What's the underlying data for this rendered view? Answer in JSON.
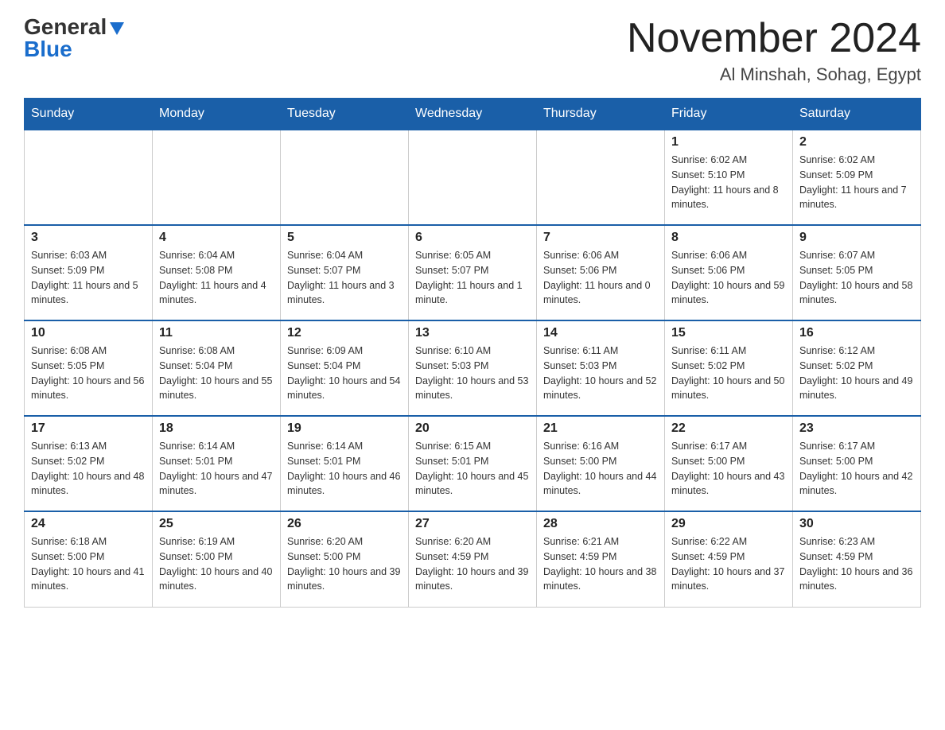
{
  "header": {
    "logo_general": "General",
    "logo_blue": "Blue",
    "month_year": "November 2024",
    "location": "Al Minshah, Sohag, Egypt"
  },
  "weekdays": [
    "Sunday",
    "Monday",
    "Tuesday",
    "Wednesday",
    "Thursday",
    "Friday",
    "Saturday"
  ],
  "weeks": [
    [
      {
        "day": "",
        "info": ""
      },
      {
        "day": "",
        "info": ""
      },
      {
        "day": "",
        "info": ""
      },
      {
        "day": "",
        "info": ""
      },
      {
        "day": "",
        "info": ""
      },
      {
        "day": "1",
        "info": "Sunrise: 6:02 AM\nSunset: 5:10 PM\nDaylight: 11 hours and 8 minutes."
      },
      {
        "day": "2",
        "info": "Sunrise: 6:02 AM\nSunset: 5:09 PM\nDaylight: 11 hours and 7 minutes."
      }
    ],
    [
      {
        "day": "3",
        "info": "Sunrise: 6:03 AM\nSunset: 5:09 PM\nDaylight: 11 hours and 5 minutes."
      },
      {
        "day": "4",
        "info": "Sunrise: 6:04 AM\nSunset: 5:08 PM\nDaylight: 11 hours and 4 minutes."
      },
      {
        "day": "5",
        "info": "Sunrise: 6:04 AM\nSunset: 5:07 PM\nDaylight: 11 hours and 3 minutes."
      },
      {
        "day": "6",
        "info": "Sunrise: 6:05 AM\nSunset: 5:07 PM\nDaylight: 11 hours and 1 minute."
      },
      {
        "day": "7",
        "info": "Sunrise: 6:06 AM\nSunset: 5:06 PM\nDaylight: 11 hours and 0 minutes."
      },
      {
        "day": "8",
        "info": "Sunrise: 6:06 AM\nSunset: 5:06 PM\nDaylight: 10 hours and 59 minutes."
      },
      {
        "day": "9",
        "info": "Sunrise: 6:07 AM\nSunset: 5:05 PM\nDaylight: 10 hours and 58 minutes."
      }
    ],
    [
      {
        "day": "10",
        "info": "Sunrise: 6:08 AM\nSunset: 5:05 PM\nDaylight: 10 hours and 56 minutes."
      },
      {
        "day": "11",
        "info": "Sunrise: 6:08 AM\nSunset: 5:04 PM\nDaylight: 10 hours and 55 minutes."
      },
      {
        "day": "12",
        "info": "Sunrise: 6:09 AM\nSunset: 5:04 PM\nDaylight: 10 hours and 54 minutes."
      },
      {
        "day": "13",
        "info": "Sunrise: 6:10 AM\nSunset: 5:03 PM\nDaylight: 10 hours and 53 minutes."
      },
      {
        "day": "14",
        "info": "Sunrise: 6:11 AM\nSunset: 5:03 PM\nDaylight: 10 hours and 52 minutes."
      },
      {
        "day": "15",
        "info": "Sunrise: 6:11 AM\nSunset: 5:02 PM\nDaylight: 10 hours and 50 minutes."
      },
      {
        "day": "16",
        "info": "Sunrise: 6:12 AM\nSunset: 5:02 PM\nDaylight: 10 hours and 49 minutes."
      }
    ],
    [
      {
        "day": "17",
        "info": "Sunrise: 6:13 AM\nSunset: 5:02 PM\nDaylight: 10 hours and 48 minutes."
      },
      {
        "day": "18",
        "info": "Sunrise: 6:14 AM\nSunset: 5:01 PM\nDaylight: 10 hours and 47 minutes."
      },
      {
        "day": "19",
        "info": "Sunrise: 6:14 AM\nSunset: 5:01 PM\nDaylight: 10 hours and 46 minutes."
      },
      {
        "day": "20",
        "info": "Sunrise: 6:15 AM\nSunset: 5:01 PM\nDaylight: 10 hours and 45 minutes."
      },
      {
        "day": "21",
        "info": "Sunrise: 6:16 AM\nSunset: 5:00 PM\nDaylight: 10 hours and 44 minutes."
      },
      {
        "day": "22",
        "info": "Sunrise: 6:17 AM\nSunset: 5:00 PM\nDaylight: 10 hours and 43 minutes."
      },
      {
        "day": "23",
        "info": "Sunrise: 6:17 AM\nSunset: 5:00 PM\nDaylight: 10 hours and 42 minutes."
      }
    ],
    [
      {
        "day": "24",
        "info": "Sunrise: 6:18 AM\nSunset: 5:00 PM\nDaylight: 10 hours and 41 minutes."
      },
      {
        "day": "25",
        "info": "Sunrise: 6:19 AM\nSunset: 5:00 PM\nDaylight: 10 hours and 40 minutes."
      },
      {
        "day": "26",
        "info": "Sunrise: 6:20 AM\nSunset: 5:00 PM\nDaylight: 10 hours and 39 minutes."
      },
      {
        "day": "27",
        "info": "Sunrise: 6:20 AM\nSunset: 4:59 PM\nDaylight: 10 hours and 39 minutes."
      },
      {
        "day": "28",
        "info": "Sunrise: 6:21 AM\nSunset: 4:59 PM\nDaylight: 10 hours and 38 minutes."
      },
      {
        "day": "29",
        "info": "Sunrise: 6:22 AM\nSunset: 4:59 PM\nDaylight: 10 hours and 37 minutes."
      },
      {
        "day": "30",
        "info": "Sunrise: 6:23 AM\nSunset: 4:59 PM\nDaylight: 10 hours and 36 minutes."
      }
    ]
  ]
}
